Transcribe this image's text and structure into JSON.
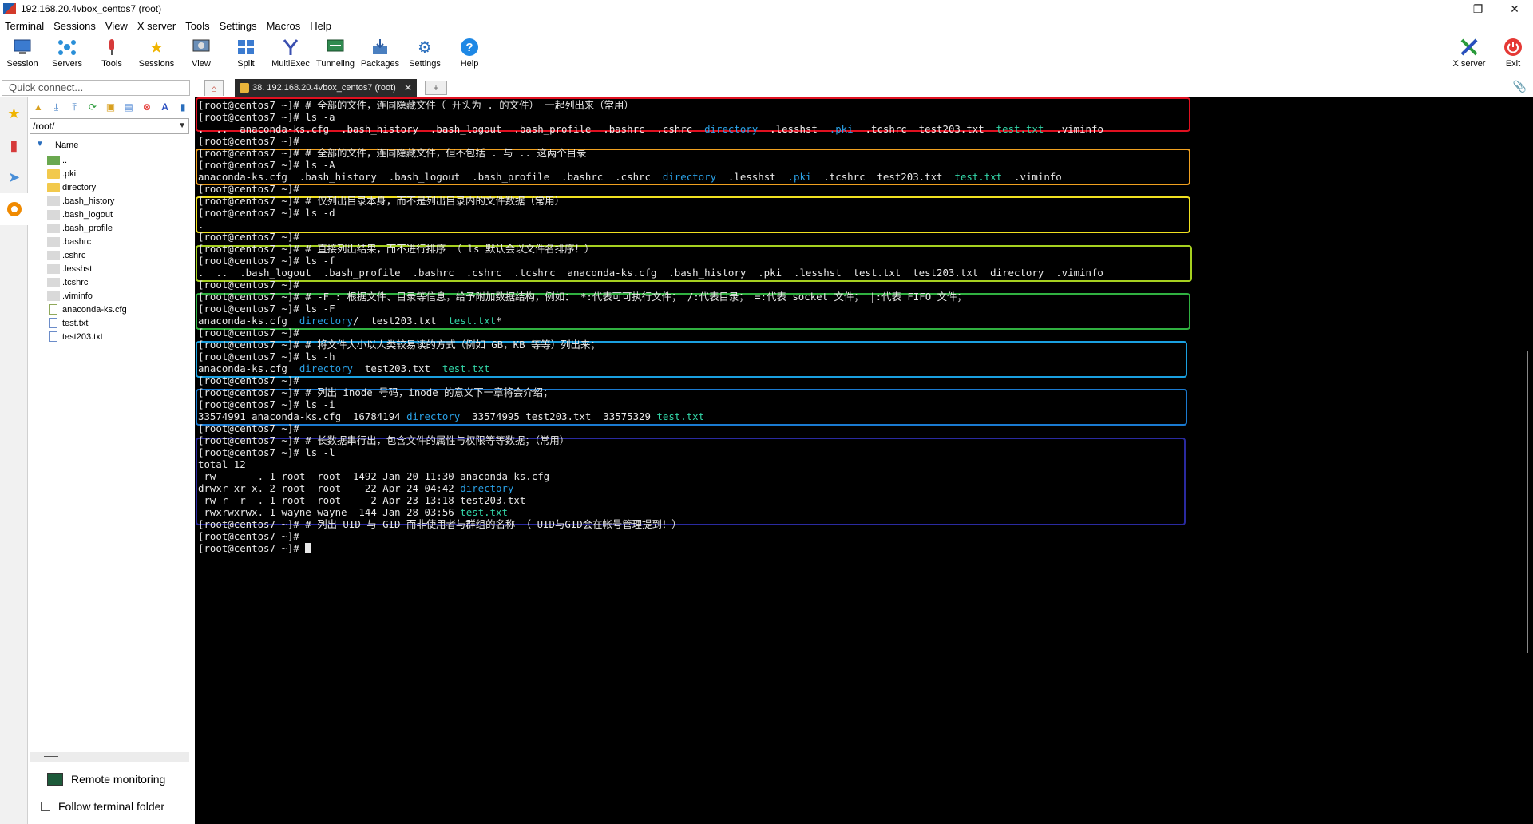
{
  "window": {
    "title": "192.168.20.4vbox_centos7 (root)",
    "controls": [
      "—",
      "❐",
      "✕"
    ]
  },
  "menu": [
    "Terminal",
    "Sessions",
    "View",
    "X server",
    "Tools",
    "Settings",
    "Macros",
    "Help"
  ],
  "toolbar": {
    "left": [
      {
        "label": "Session",
        "icon": "session-icon"
      },
      {
        "label": "Servers",
        "icon": "servers-icon"
      },
      {
        "label": "Tools",
        "icon": "tools-icon"
      },
      {
        "label": "Sessions",
        "icon": "sessions-star-icon"
      },
      {
        "label": "View",
        "icon": "view-icon"
      },
      {
        "label": "Split",
        "icon": "split-icon"
      },
      {
        "label": "MultiExec",
        "icon": "multiexec-icon"
      },
      {
        "label": "Tunneling",
        "icon": "tunneling-icon"
      },
      {
        "label": "Packages",
        "icon": "packages-icon"
      },
      {
        "label": "Settings",
        "icon": "settings-gear-icon"
      },
      {
        "label": "Help",
        "icon": "help-icon"
      }
    ],
    "right": [
      {
        "label": "X server",
        "icon": "xserver-icon"
      },
      {
        "label": "Exit",
        "icon": "exit-power-icon"
      }
    ]
  },
  "quick_connect": {
    "placeholder": "Quick connect..."
  },
  "tab": {
    "label": "38. 192.168.20.4vbox_centos7 (root)"
  },
  "sidebar": {
    "path": "/root/",
    "tree_header": "Name",
    "items": [
      {
        "name": "..",
        "kind": "up"
      },
      {
        "name": ".pki",
        "kind": "folder"
      },
      {
        "name": "directory",
        "kind": "folder"
      },
      {
        "name": ".bash_history",
        "kind": "hidden"
      },
      {
        "name": ".bash_logout",
        "kind": "hidden"
      },
      {
        "name": ".bash_profile",
        "kind": "hidden"
      },
      {
        "name": ".bashrc",
        "kind": "hidden"
      },
      {
        "name": ".cshrc",
        "kind": "hidden"
      },
      {
        "name": ".lesshst",
        "kind": "hidden"
      },
      {
        "name": ".tcshrc",
        "kind": "hidden"
      },
      {
        "name": ".viminfo",
        "kind": "hidden"
      },
      {
        "name": "anaconda-ks.cfg",
        "kind": "cfg"
      },
      {
        "name": "test.txt",
        "kind": "doc"
      },
      {
        "name": "test203.txt",
        "kind": "doc"
      }
    ],
    "remote_monitoring": "Remote monitoring",
    "follow_terminal_folder": "Follow terminal folder"
  },
  "colors": {
    "terminal_bg": "#000000",
    "dir_blue": "#2aa1e6",
    "file_green": "#33d6a8",
    "box_red": "#e01020",
    "box_orange": "#f0a020",
    "box_yellow": "#f0e020",
    "box_lime": "#a6d020",
    "box_green": "#30b040",
    "box_cyan": "#1aa0e0",
    "box_blue": "#1a7ad0",
    "box_navy": "#2a2aa0"
  },
  "terminal": {
    "lines": [
      [
        {
          "t": "[root@centos7 ~]# # 全部的文件，连同隐藏文件（ 开头为 . 的文件） 一起列出来（常用）"
        }
      ],
      [
        {
          "t": "[root@centos7 ~]# ls -a"
        }
      ],
      [
        {
          "t": ".  ..  anaconda-ks.cfg  .bash_history  .bash_logout  .bash_profile  .bashrc  .cshrc  "
        },
        {
          "t": "directory",
          "c": "blue"
        },
        {
          "t": "  .lesshst  "
        },
        {
          "t": ".pki",
          "c": "blue"
        },
        {
          "t": "  .tcshrc  test203.txt  "
        },
        {
          "t": "test.txt",
          "c": "green"
        },
        {
          "t": "  .viminfo"
        }
      ],
      [
        {
          "t": "[root@centos7 ~]#"
        }
      ],
      [
        {
          "t": "[root@centos7 ~]# # 全部的文件，连同隐藏文件，但不包括 . 与 .. 这两个目录"
        }
      ],
      [
        {
          "t": "[root@centos7 ~]# ls -A"
        }
      ],
      [
        {
          "t": "anaconda-ks.cfg  .bash_history  .bash_logout  .bash_profile  .bashrc  .cshrc  "
        },
        {
          "t": "directory",
          "c": "blue"
        },
        {
          "t": "  .lesshst  "
        },
        {
          "t": ".pki",
          "c": "blue"
        },
        {
          "t": "  .tcshrc  test203.txt  "
        },
        {
          "t": "test.txt",
          "c": "green"
        },
        {
          "t": "  .viminfo"
        }
      ],
      [
        {
          "t": "[root@centos7 ~]#"
        }
      ],
      [
        {
          "t": "[root@centos7 ~]# # 仅列出目录本身，而不是列出目录内的文件数据（常用）"
        }
      ],
      [
        {
          "t": "[root@centos7 ~]# ls -d"
        }
      ],
      [
        {
          "t": "."
        }
      ],
      [
        {
          "t": "[root@centos7 ~]#"
        }
      ],
      [
        {
          "t": "[root@centos7 ~]# # 直接列出结果，而不进行排序 （ ls 默认会以文件名排序！）"
        }
      ],
      [
        {
          "t": "[root@centos7 ~]# ls -f"
        }
      ],
      [
        {
          "t": ".  ..  .bash_logout  .bash_profile  .bashrc  .cshrc  .tcshrc  anaconda-ks.cfg  .bash_history  .pki  .lesshst  test.txt  test203.txt  directory  .viminfo"
        }
      ],
      [
        {
          "t": "[root@centos7 ~]#"
        }
      ],
      [
        {
          "t": "[root@centos7 ~]# # -F : 根据文件、目录等信息，给予附加数据结构，例如： *:代表可可执行文件； /:代表目录； =:代表 socket 文件； |:代表 FIFO 文件；"
        }
      ],
      [
        {
          "t": "[root@centos7 ~]# ls -F"
        }
      ],
      [
        {
          "t": "anaconda-ks.cfg  "
        },
        {
          "t": "directory",
          "c": "blue"
        },
        {
          "t": "/  test203.txt  "
        },
        {
          "t": "test.txt",
          "c": "green"
        },
        {
          "t": "*"
        }
      ],
      [
        {
          "t": "[root@centos7 ~]#"
        }
      ],
      [
        {
          "t": "[root@centos7 ~]# # 将文件大小以人类较易读的方式（例如 GB，KB 等等）列出来；"
        }
      ],
      [
        {
          "t": "[root@centos7 ~]# ls -h"
        }
      ],
      [
        {
          "t": "anaconda-ks.cfg  "
        },
        {
          "t": "directory",
          "c": "blue"
        },
        {
          "t": "  test203.txt  "
        },
        {
          "t": "test.txt",
          "c": "green"
        }
      ],
      [
        {
          "t": "[root@centos7 ~]#"
        }
      ],
      [
        {
          "t": "[root@centos7 ~]# # 列出 inode 号码，inode 的意义下一章将会介绍；"
        }
      ],
      [
        {
          "t": "[root@centos7 ~]# ls -i"
        }
      ],
      [
        {
          "t": "33574991 anaconda-ks.cfg  16784194 "
        },
        {
          "t": "directory",
          "c": "blue"
        },
        {
          "t": "  33574995 test203.txt  33575329 "
        },
        {
          "t": "test.txt",
          "c": "green"
        }
      ],
      [
        {
          "t": "[root@centos7 ~]#"
        }
      ],
      [
        {
          "t": "[root@centos7 ~]# # 长数据串行出，包含文件的属性与权限等等数据；（常用）"
        }
      ],
      [
        {
          "t": "[root@centos7 ~]# ls -l"
        }
      ],
      [
        {
          "t": "total 12"
        }
      ],
      [
        {
          "t": "-rw-------. 1 root  root  1492 Jan 20 11:30 anaconda-ks.cfg"
        }
      ],
      [
        {
          "t": "drwxr-xr-x. 2 root  root    22 Apr 24 04:42 "
        },
        {
          "t": "directory",
          "c": "blue"
        }
      ],
      [
        {
          "t": "-rw-r--r--. 1 root  root     2 Apr 23 13:18 test203.txt"
        }
      ],
      [
        {
          "t": "-rwxrwxrwx. 1 wayne wayne  144 Jan 28 03:56 "
        },
        {
          "t": "test.txt",
          "c": "green"
        }
      ],
      [
        {
          "t": "[root@centos7 ~]# # 列出 UID 与 GID 而非使用者与群组的名称 （ UID与GID会在帐号管理提到！）"
        }
      ],
      [
        {
          "t": "[root@centos7 ~]#"
        }
      ],
      [
        {
          "t": "[root@centos7 ~]# "
        },
        {
          "t": "",
          "c": "cursor"
        }
      ]
    ]
  }
}
